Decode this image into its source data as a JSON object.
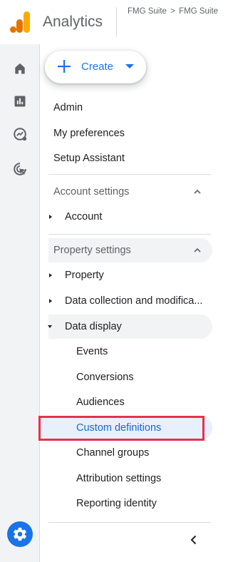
{
  "header": {
    "app_title": "Analytics",
    "breadcrumb": [
      "FMG Suite",
      "FMG Suite"
    ],
    "breadcrumb_separator": ">"
  },
  "rail": {
    "icons": [
      "home-icon",
      "reports-icon",
      "explore-icon",
      "advertising-icon"
    ],
    "settings_icon": "gear-icon"
  },
  "create": {
    "label": "Create"
  },
  "nav": {
    "top_items": [
      "Admin",
      "My preferences",
      "Setup Assistant"
    ],
    "account_settings": {
      "title": "Account settings",
      "items": [
        "Account"
      ]
    },
    "property_settings": {
      "title": "Property settings",
      "items": [
        "Property",
        "Data collection and modifica...",
        "Data display"
      ],
      "data_display_children": [
        "Events",
        "Conversions",
        "Audiences",
        "Custom definitions",
        "Channel groups",
        "Attribution settings",
        "Reporting identity"
      ],
      "active_item": "Custom definitions"
    }
  },
  "colors": {
    "accent": "#1a73e8",
    "active_bg": "#e8f0fe",
    "highlight_border": "#e8314a",
    "logo_orange": "#f9ab00",
    "logo_dark_orange": "#e37400"
  }
}
